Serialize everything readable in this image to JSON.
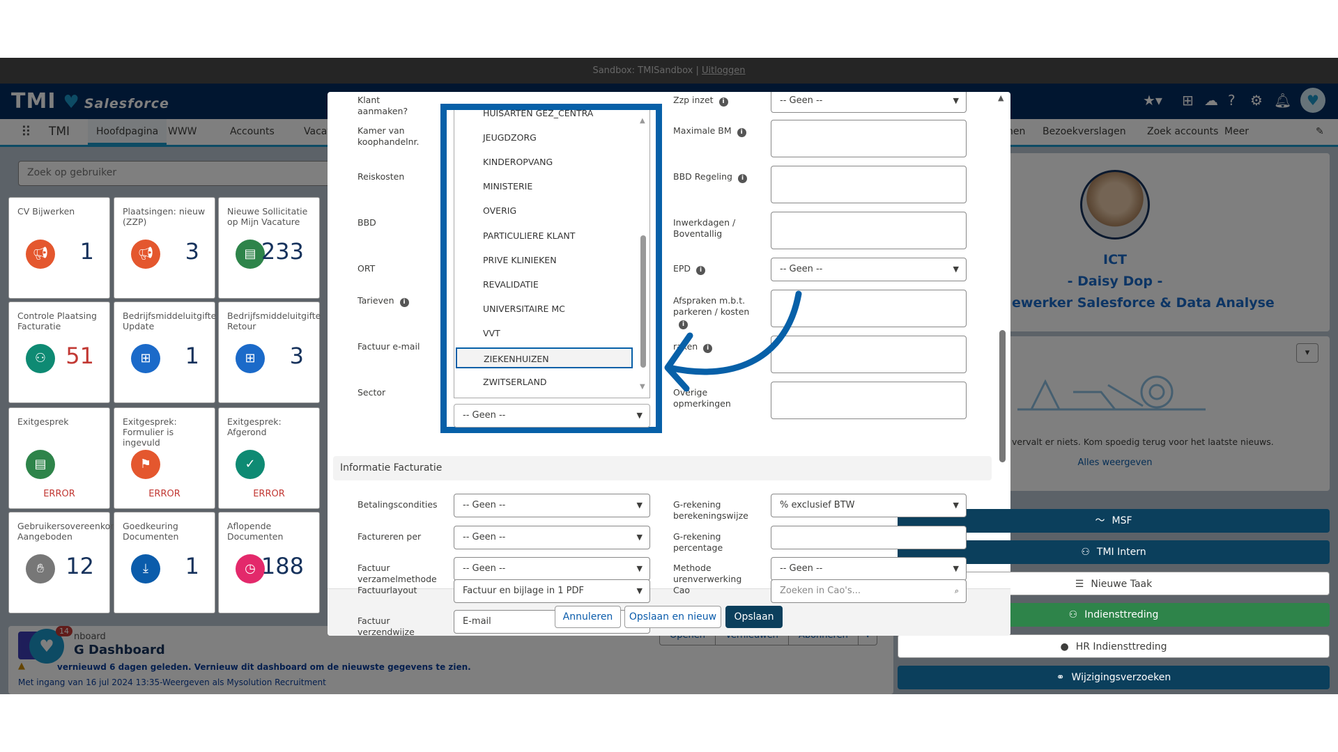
{
  "topbar": {
    "sandbox_text": "Sandbox: TMISandbox |",
    "logout_link": "Uitloggen"
  },
  "header": {
    "logo": "TMI",
    "brand": "Salesforce",
    "app_name": "TMI"
  },
  "nav": {
    "items": [
      "Hoofdpagina",
      "WWW",
      "Accounts",
      "Vacat",
      "nen",
      "Bezoekverslagen",
      "Zoek accounts",
      "Meer"
    ]
  },
  "search": {
    "placeholder": "Zoek op gebruiker"
  },
  "tiles": [
    {
      "title": "CV Bijwerken",
      "value": "1",
      "icon": "megaphone-icon",
      "color": "#e4572e"
    },
    {
      "title": "Plaatsingen: nieuw (ZZP)",
      "value": "3",
      "icon": "megaphone-icon",
      "color": "#e4572e"
    },
    {
      "title": "Nieuwe Sollicitatie op Mijn Vacature",
      "value": "233",
      "icon": "document-icon",
      "color": "#2e844a"
    },
    {
      "title": "Controle Plaatsing Facturatie",
      "value": "51",
      "icon": "user-assign-icon",
      "color": "#0e8a73",
      "value_color": "#c23934"
    },
    {
      "title": "Bedrijfsmiddeluitgifte Update",
      "value": "1",
      "icon": "form-add-icon",
      "color": "#1b6ac9"
    },
    {
      "title": "Bedrijfsmiddeluitgifte Retour",
      "value": "3",
      "icon": "form-add-icon",
      "color": "#1b6ac9"
    },
    {
      "title": "Exitgesprek",
      "value": "ERROR",
      "icon": "document-icon",
      "color": "#2e844a",
      "error": true
    },
    {
      "title": "Exitgesprek: Formulier is ingevuld",
      "value": "ERROR",
      "icon": "flag-icon",
      "color": "#e4572e",
      "error": true
    },
    {
      "title": "Exitgesprek: Afgerond",
      "value": "ERROR",
      "icon": "check-icon",
      "color": "#0e8a73",
      "error": true
    },
    {
      "title": "Gebruikersovereenkomst Aangeboden",
      "value": "12",
      "icon": "handshake-icon",
      "color": "#777777"
    },
    {
      "title": "Goedkeuring Documenten",
      "value": "1",
      "icon": "download-icon",
      "color": "#0b5cab"
    },
    {
      "title": "Aflopende Documenten",
      "value": "188",
      "icon": "clock-icon",
      "color": "#e3296b"
    }
  ],
  "dashboard": {
    "label": "nboard",
    "title": "G Dashboard",
    "warning": "vernieuwd 6 dagen geleden. Vernieuw dit dashboard om de nieuwste gegevens te zien.",
    "note": "Met ingang van 16 jul 2024 13:35-Weergeven als Mysolution Recruitment",
    "badge": "14",
    "buttons": [
      "Openen",
      "Vernieuwen",
      "Abonneren"
    ]
  },
  "profile": {
    "line1": "ICT",
    "line2": "- Daisy Dop -",
    "line3": "ewerker Salesforce & Data Analyse"
  },
  "news": {
    "empty": "vervalt er niets. Kom spoedig terug voor het laatste nieuws.",
    "view_all": "Alles weergeven"
  },
  "actions": [
    {
      "label": "MSF",
      "icon": "chart-line-icon",
      "style": "dark"
    },
    {
      "label": "TMI Intern",
      "icon": "users-icon",
      "style": "dark"
    },
    {
      "label": "Nieuwe Taak",
      "icon": "task-icon",
      "style": "light"
    },
    {
      "label": "Indiensttreding",
      "icon": "user-plus-icon",
      "style": "green"
    },
    {
      "label": "HR Indiensttreding",
      "icon": "chat-icon",
      "style": "light"
    },
    {
      "label": "Wijzigingsverzoeken",
      "icon": "link-icon",
      "style": "dark"
    }
  ],
  "colors": {
    "brand": "#032d60",
    "accent": "#0760a8",
    "dark_button": "#0b3f5c",
    "green": "#2e844a"
  },
  "modal": {
    "left_labels": [
      "Klant aanmaken?",
      "Kamer van koophandelnr.",
      "Reiskosten",
      "BBD",
      "ORT",
      "Tarieven",
      "Factuur e-mail",
      "Sector"
    ],
    "right_labels": [
      "Zzp inzet",
      "Maximale BM",
      "BBD Regeling",
      "Inwerkdagen / Boventallig",
      "EPD",
      "Afspraken m.b.t. parkeren / kosten",
      "raken",
      "Overige opmerkingen"
    ],
    "zzp_value": "-- Geen --",
    "epd_value": "-- Geen --",
    "sector": {
      "value": "-- Geen --",
      "options": [
        "HUISARTEN GEZ_CENTRA",
        "JEUGDZORG",
        "KINDEROPVANG",
        "MINISTERIE",
        "OVERIG",
        "PARTICULIERE KLANT",
        "PRIVE KLINIEKEN",
        "REVALIDATIE",
        "UNIVERSITAIRE MC",
        "VVT",
        "ZIEKENHUIZEN",
        "ZWITSERLAND"
      ],
      "highlighted": "ZIEKENHUIZEN"
    },
    "section_title": "Informatie Facturatie",
    "billing_left": [
      {
        "label": "Betalingscondities",
        "value": "-- Geen --"
      },
      {
        "label": "Factureren per",
        "value": "-- Geen --"
      },
      {
        "label": "Factuur verzamelmethode",
        "value": "-- Geen --"
      },
      {
        "label": "Factuurlayout",
        "value": "Factuur en bijlage in 1 PDF"
      },
      {
        "label": "Factuur verzendwijze",
        "value": "E-mail"
      }
    ],
    "billing_right": [
      {
        "label": "G-rekening berekeningswijze",
        "value": "% exclusief BTW"
      },
      {
        "label": "G-rekening percentage",
        "value": ""
      },
      {
        "label": "Methode urenverwerking",
        "value": "-- Geen --"
      },
      {
        "label": "Cao",
        "value": "Zoeken in Cao's..."
      }
    ],
    "buttons": {
      "cancel": "Annuleren",
      "save_new": "Opslaan en nieuw",
      "save": "Opslaan"
    }
  }
}
